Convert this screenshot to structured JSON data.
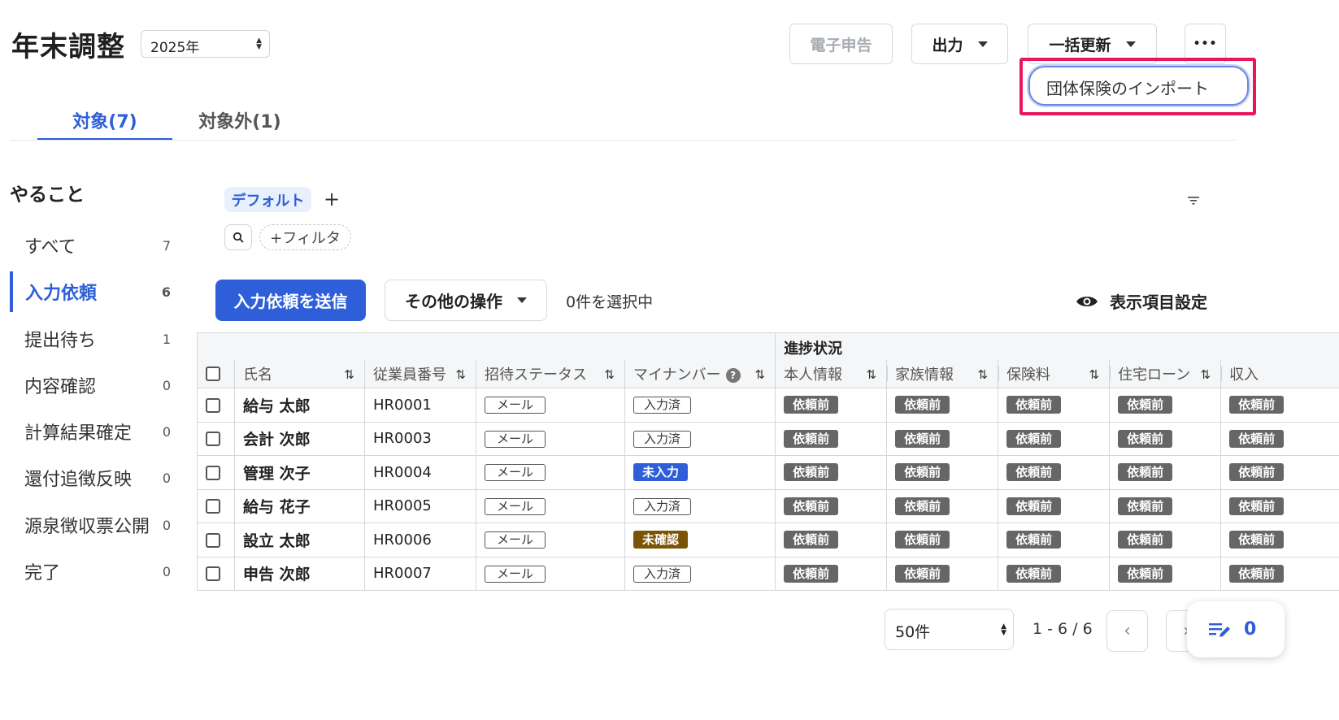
{
  "header": {
    "title": "年末調整",
    "year": "2025年",
    "e_filing_label": "電子申告",
    "output_label": "出力",
    "bulk_update_label": "一括更新",
    "more_label": "•••"
  },
  "dropdown": {
    "import_group_insurance": "団体保険のインポート"
  },
  "tabs": [
    {
      "label": "対象(7)"
    },
    {
      "label": "対象外(1)"
    }
  ],
  "sidebar": {
    "heading": "やること",
    "items": [
      {
        "label": "すべて",
        "count": "7"
      },
      {
        "label": "入力依頼",
        "count": "6"
      },
      {
        "label": "提出待ち",
        "count": "1"
      },
      {
        "label": "内容確認",
        "count": "0"
      },
      {
        "label": "計算結果確定",
        "count": "0"
      },
      {
        "label": "還付追徴反映",
        "count": "0"
      },
      {
        "label": "源泉徴収票公開",
        "count": "0"
      },
      {
        "label": "完了",
        "count": "0"
      }
    ]
  },
  "views": {
    "default_label": "デフォルト",
    "add_label": "+"
  },
  "filter": {
    "add_filter_label": "+フィルタ"
  },
  "actions": {
    "send_request_label": "入力依頼を送信",
    "other_ops_label": "その他の操作",
    "selected_count": "0件を選択中",
    "display_settings_label": "表示項目設定"
  },
  "table": {
    "group_header": "進捗状況",
    "columns": {
      "name": "氏名",
      "employee_no": "従業員番号",
      "invite_status": "招待ステータス",
      "my_number": "マイナンバー",
      "self_info": "本人情報",
      "family_info": "家族情報",
      "insurance": "保険料",
      "housing_loan": "住宅ローン",
      "income": "収入"
    },
    "rows": [
      {
        "name": "給与 太郎",
        "employee_no": "HR0001",
        "invite": "メール",
        "my_number": "入力済",
        "progress": [
          "依頼前",
          "依頼前",
          "依頼前",
          "依頼前",
          "依頼前"
        ]
      },
      {
        "name": "会計 次郎",
        "employee_no": "HR0003",
        "invite": "メール",
        "my_number": "入力済",
        "progress": [
          "依頼前",
          "依頼前",
          "依頼前",
          "依頼前",
          "依頼前"
        ]
      },
      {
        "name": "管理 次子",
        "employee_no": "HR0004",
        "invite": "メール",
        "my_number": "未入力",
        "progress": [
          "依頼前",
          "依頼前",
          "依頼前",
          "依頼前",
          "依頼前"
        ]
      },
      {
        "name": "給与 花子",
        "employee_no": "HR0005",
        "invite": "メール",
        "my_number": "入力済",
        "progress": [
          "依頼前",
          "依頼前",
          "依頼前",
          "依頼前",
          "依頼前"
        ]
      },
      {
        "name": "設立 太郎",
        "employee_no": "HR0006",
        "invite": "メール",
        "my_number": "未確認",
        "progress": [
          "依頼前",
          "依頼前",
          "依頼前",
          "依頼前",
          "依頼前"
        ]
      },
      {
        "name": "申告 次郎",
        "employee_no": "HR0007",
        "invite": "メール",
        "my_number": "入力済",
        "progress": [
          "依頼前",
          "依頼前",
          "依頼前",
          "依頼前",
          "依頼前"
        ]
      }
    ]
  },
  "pagination": {
    "per_page": "50件",
    "range": "1 - 6 / 6"
  },
  "fab": {
    "count": "0"
  },
  "colors": {
    "accent": "#2f5fd8",
    "highlight": "#e8175d",
    "unconfirmed": "#7a5306"
  }
}
